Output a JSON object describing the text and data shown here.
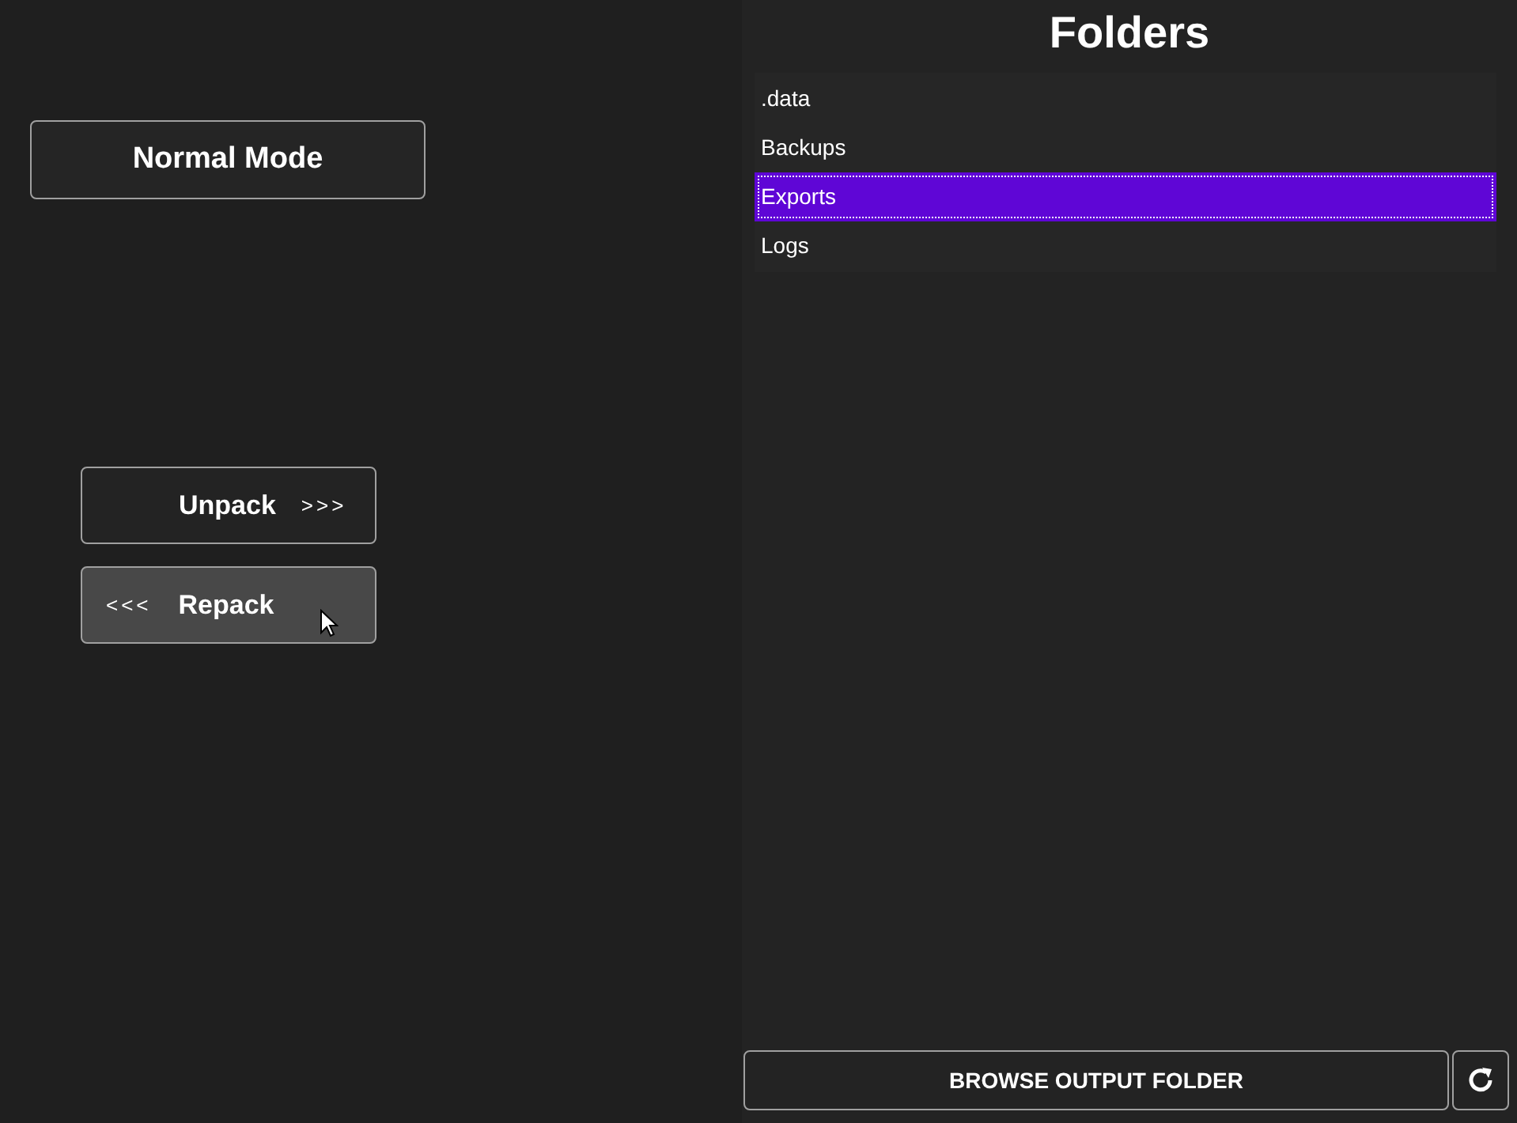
{
  "mode_button": {
    "label": "Normal Mode"
  },
  "actions": [
    {
      "kind": "unpack",
      "label": "Unpack",
      "arrows": ">>>",
      "hovered": false
    },
    {
      "kind": "repack",
      "label": "Repack",
      "arrows": "<<<",
      "hovered": true
    }
  ],
  "folders": {
    "title": "Folders",
    "items": [
      {
        "label": ".data",
        "selected": false
      },
      {
        "label": "Backups",
        "selected": false
      },
      {
        "label": "Exports",
        "selected": true
      },
      {
        "label": "Logs",
        "selected": false
      }
    ]
  },
  "browse_button": {
    "label": "BROWSE OUTPUT FOLDER"
  }
}
